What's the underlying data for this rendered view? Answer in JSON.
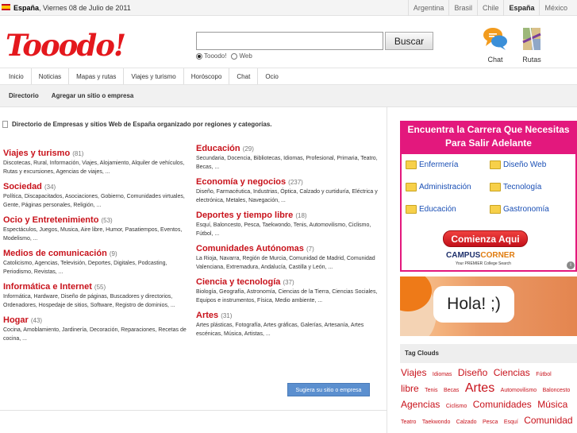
{
  "topbar": {
    "country": "España",
    "date": ", Viernes 08 de Julio de 2011",
    "countries": [
      "Argentina",
      "Brasil",
      "Chile",
      "España",
      "México"
    ],
    "selected_country": "España"
  },
  "logo": "Tooodo!",
  "search": {
    "value": "",
    "button": "Buscar",
    "options": [
      "Tooodo!",
      "Web"
    ],
    "selected": "Tooodo!"
  },
  "tools": [
    {
      "label": "Chat",
      "icon": "chat-icon"
    },
    {
      "label": "Rutas",
      "icon": "routes-icon"
    }
  ],
  "nav": [
    "Inicio",
    "Noticias",
    "Mapas y rutas",
    "Viajes y turismo",
    "Horóscopo",
    "Chat",
    "Ocio"
  ],
  "subnav": [
    "Directorio",
    "Agregar un sitio o empresa"
  ],
  "intro": "Directorio de Empresas y sitios Web de España organizado por regiones y categorías.",
  "categories_left": [
    {
      "title": "Viajes y turismo",
      "count": "(81)",
      "desc": "Discotecas, Rural, Información, Viajes, Alojamiento, Alquiler de vehículos, Rutas y excursiones, Agencias de viajes, ..."
    },
    {
      "title": "Sociedad",
      "count": "(34)",
      "desc": "Política, Discapacitados, Asociaciones, Gobierno, Comunidades virtuales, Gente, Páginas personales, Religión, ..."
    },
    {
      "title": "Ocio y Entretenimiento",
      "count": "(53)",
      "desc": "Espectáculos, Juegos, Musica, Aire libre, Humor, Pasatiempos, Eventos, Modelismo, ..."
    },
    {
      "title": "Medios de comunicación",
      "count": "(9)",
      "desc": "Catolicismo, Agencias, Televisión, Deportes, Digitales, Podcasting, Periodismo, Revistas, ..."
    },
    {
      "title": "Informática e Internet",
      "count": "(55)",
      "desc": "Informática, Hardware, Diseño de páginas, Buscadores y directorios, Ordenadores, Hospedaje de sitios, Software, Registro de dominios, ..."
    },
    {
      "title": "Hogar",
      "count": "(43)",
      "desc": "Cocina, Amoblamiento, Jardinería, Decoración, Reparaciones, Recetas de cocina, ..."
    }
  ],
  "categories_right": [
    {
      "title": "Educación",
      "count": "(29)",
      "desc": "Secundaria, Docencia, Bibliotecas, Idiomas, Profesional, Primaria, Teatro, Becas, ..."
    },
    {
      "title": "Economía y negocios",
      "count": "(237)",
      "desc": "Diseño, Farmacéutica, Industrias, Óptica, Calzado y curtiduría, Eléctrica y electrónica, Metales, Navegación, ..."
    },
    {
      "title": "Deportes y tiempo libre",
      "count": "(18)",
      "desc": "Esquí, Baloncesto, Pesca, Taekwondo, Tenis, Automovilismo, Ciclismo, Fútbol, ..."
    },
    {
      "title": "Comunidades Autónomas",
      "count": "(7)",
      "desc": "La Rioja, Navarra, Región de Murcia, Comunidad de Madrid, Comunidad Valenciana, Extremadura, Andalucía, Castilla y León, ..."
    },
    {
      "title": "Ciencia y tecnología",
      "count": "(37)",
      "desc": "Biología, Geografía, Astronomía, Ciencias de la Tierra, Ciencias Sociales, Equipos e instrumentos, Física, Medio ambiente, ..."
    },
    {
      "title": "Artes",
      "count": "(31)",
      "desc": "Artes plásticas, Fotografía, Artes gráficas, Galerías, Artesanía, Artes escénicas, Música, Artistas, ..."
    }
  ],
  "suggest_button": "Sugiera su sitio o empresa",
  "ad_campus": {
    "headline": "Encuentra la Carrera Que Necesitas Para Salir Adelante",
    "items": [
      "Enfermería",
      "Diseño Web",
      "Administración",
      "Tecnología",
      "Educación",
      "Gastronomía"
    ],
    "cta": "Comienza Aqui",
    "brand_a": "CAMPUS",
    "brand_b": "CORNER",
    "brand_tagline": "Your PREMIER College Search",
    "info": "i"
  },
  "ad_hola": {
    "text": "Hola! ;)"
  },
  "tag_clouds": {
    "title": "Tag Clouds",
    "tags": [
      {
        "t": "Viajes",
        "s": 12
      },
      {
        "t": "Idiomas",
        "s": 7
      },
      {
        "t": "Diseño",
        "s": 12
      },
      {
        "t": "Ciencias",
        "s": 12
      },
      {
        "t": "Fútbol",
        "s": 7
      },
      {
        "t": "libre",
        "s": 12
      },
      {
        "t": "Tenis",
        "s": 7
      },
      {
        "t": "Becas",
        "s": 7
      },
      {
        "t": "Artes",
        "s": 16
      },
      {
        "t": "Automovilismo",
        "s": 7
      },
      {
        "t": "Baloncesto",
        "s": 7
      },
      {
        "t": "Agencias",
        "s": 12
      },
      {
        "t": "Ciclismo",
        "s": 7
      },
      {
        "t": "Comunidades",
        "s": 12
      },
      {
        "t": "Música",
        "s": 12
      },
      {
        "t": "Teatro",
        "s": 7
      },
      {
        "t": "Taekwondo",
        "s": 7
      },
      {
        "t": "Calzado",
        "s": 7
      },
      {
        "t": "Pesca",
        "s": 7
      },
      {
        "t": "Esquí",
        "s": 7
      },
      {
        "t": "Comunidad",
        "s": 12
      }
    ]
  },
  "colors": {
    "accent": "#c8121b",
    "ad_pink": "#e3187d",
    "button_blue": "#5b8fcf"
  }
}
